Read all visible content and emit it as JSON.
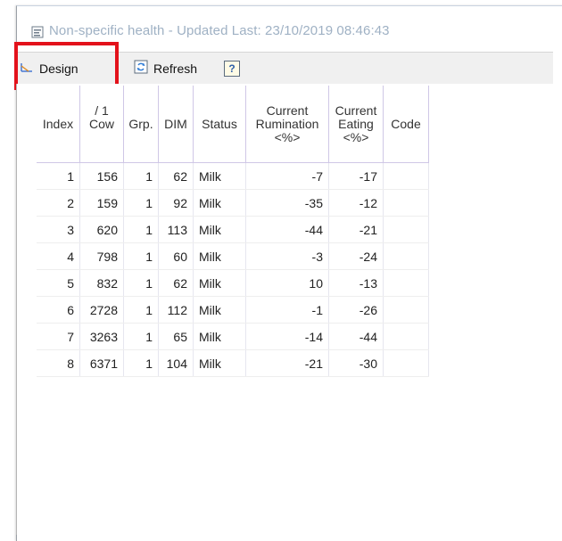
{
  "window": {
    "title": "Non-specific health - Updated Last: 23/10/2019 08:46:43"
  },
  "toolbar": {
    "design_label": "Design",
    "refresh_label": "Refresh",
    "help_label": "?"
  },
  "table": {
    "headers": {
      "index": "Index",
      "cow_top": "/ 1",
      "cow": "Cow",
      "grp": "Grp.",
      "dim": "DIM",
      "status": "Status",
      "rumination_1": "Current",
      "rumination_2": "Rumination",
      "rumination_3": "<%>",
      "eating_1": "Current",
      "eating_2": "Eating",
      "eating_3": "<%>",
      "code": "Code"
    },
    "rows": [
      {
        "index": "1",
        "cow": "156",
        "grp": "1",
        "dim": "62",
        "status": "Milk",
        "rumination": "-7",
        "eating": "-17",
        "code": ""
      },
      {
        "index": "2",
        "cow": "159",
        "grp": "1",
        "dim": "92",
        "status": "Milk",
        "rumination": "-35",
        "eating": "-12",
        "code": ""
      },
      {
        "index": "3",
        "cow": "620",
        "grp": "1",
        "dim": "113",
        "status": "Milk",
        "rumination": "-44",
        "eating": "-21",
        "code": ""
      },
      {
        "index": "4",
        "cow": "798",
        "grp": "1",
        "dim": "60",
        "status": "Milk",
        "rumination": "-3",
        "eating": "-24",
        "code": ""
      },
      {
        "index": "5",
        "cow": "832",
        "grp": "1",
        "dim": "62",
        "status": "Milk",
        "rumination": "10",
        "eating": "-13",
        "code": ""
      },
      {
        "index": "6",
        "cow": "2728",
        "grp": "1",
        "dim": "112",
        "status": "Milk",
        "rumination": "-1",
        "eating": "-26",
        "code": ""
      },
      {
        "index": "7",
        "cow": "3263",
        "grp": "1",
        "dim": "65",
        "status": "Milk",
        "rumination": "-14",
        "eating": "-44",
        "code": ""
      },
      {
        "index": "8",
        "cow": "6371",
        "grp": "1",
        "dim": "104",
        "status": "Milk",
        "rumination": "-21",
        "eating": "-30",
        "code": ""
      }
    ]
  },
  "colors": {
    "highlight": "#e3121b",
    "title_text": "#9fb1c4",
    "header_border": "#cfc7e6"
  },
  "icons": {
    "window": "window-icon",
    "design": "design-icon",
    "refresh": "refresh-icon",
    "help": "help-icon"
  }
}
